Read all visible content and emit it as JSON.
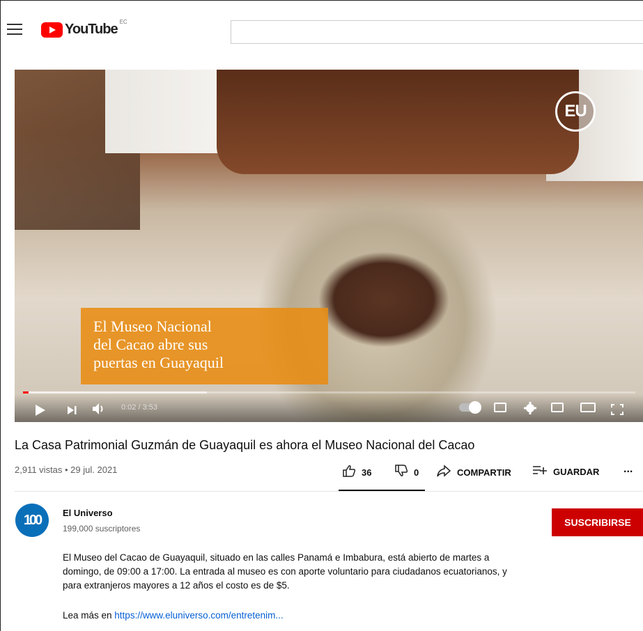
{
  "header": {
    "logo_text": "YouTube",
    "country_code": "EC",
    "search_value": ""
  },
  "player": {
    "badge_text": "EU",
    "overlay_lines": [
      "El Museo Nacional",
      "del Cacao abre sus",
      "puertas en Guayaquil"
    ],
    "time": "0:02 / 3:53",
    "progress_fraction": 0.0086
  },
  "video": {
    "title": "La Casa Patrimonial Guzmán de Guayaquil es ahora el Museo Nacional del Cacao",
    "meta": "2,911 vistas • 29 jul. 2021",
    "actions": {
      "like_count": "36",
      "dislike_count": "0",
      "share_label": "COMPARTIR",
      "save_label": "GUARDAR",
      "more_label": "..."
    }
  },
  "channel": {
    "avatar_text": "100",
    "name": "El Universo",
    "subscribers": "199,000 suscriptores",
    "subscribe_label": "SUSCRIBIRSE"
  },
  "description": {
    "text": "El Museo del Cacao de Guayaquil, situado en las calles Panamá e Imbabura, está abierto de martes a domingo, de 09:00 a 17:00. La entrada al museo es con aporte voluntario para ciudadanos ecuatorianos, y para extranjeros mayores a 12 años el costo es de $5.",
    "more_prefix": "Lea más en ",
    "more_link": "https://www.eluniverso.com/entretenim..."
  },
  "icons": [
    "menu-icon",
    "youtube-logo-icon",
    "play-icon",
    "next-icon",
    "volume-icon",
    "autoplay-toggle-icon",
    "subtitles-icon",
    "settings-icon",
    "miniplayer-icon",
    "theater-icon",
    "fullscreen-icon",
    "like-icon",
    "dislike-icon",
    "share-icon",
    "save-icon",
    "more-icon"
  ],
  "colors": {
    "brand_red": "#ff0000",
    "subscribe_red": "#cc0000",
    "overlay_orange": "#e88c12",
    "link_blue": "#065fd4"
  }
}
